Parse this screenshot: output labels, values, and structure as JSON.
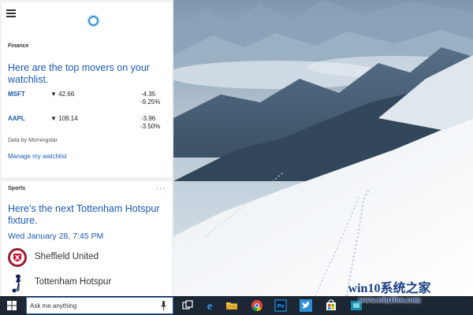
{
  "cortana": {
    "finance": {
      "section": "Finance",
      "headline": "Here are the top movers on your watchlist.",
      "stocks": [
        {
          "symbol": "MSFT",
          "price": "▼ 42.66",
          "change": "-4.35",
          "percent": "-9.25%"
        },
        {
          "symbol": "AAPL",
          "price": "▼ 109.14",
          "change": "-3.96",
          "percent": "-3.50%"
        }
      ],
      "attribution": "Data by Morningstar",
      "manage_link": "Manage my watchlist"
    },
    "sports": {
      "section": "Sports",
      "more": "···",
      "headline": "Here's the next Tottenham Hotspur fixture.",
      "datetime": "Wed January 28, 7:45 PM",
      "teams": [
        {
          "name": "Sheffield United"
        },
        {
          "name": "Tottenham Hotspur"
        }
      ]
    }
  },
  "taskbar": {
    "search_placeholder": "Ask me anything",
    "icons": [
      "task-view-icon",
      "edge-icon",
      "file-explorer-icon",
      "chrome-icon",
      "photoshop-icon",
      "twitter-icon",
      "store-icon",
      "app-icon"
    ]
  },
  "watermark": {
    "line1": "win10系统之家",
    "line2": "www.win10os.com"
  },
  "colors": {
    "accent": "#1b59b3",
    "cortana_ring": "#2e8fe0",
    "taskbar": "#1d2633"
  }
}
